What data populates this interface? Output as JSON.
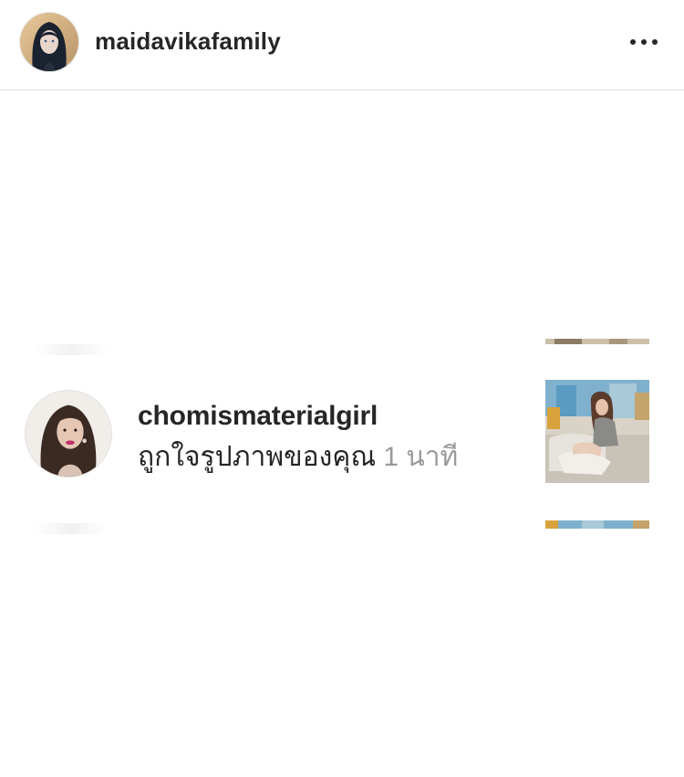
{
  "header": {
    "username": "maidavikafamily",
    "avatar_icon": "profile-photo",
    "more_icon": "more-horizontal-icon"
  },
  "notification": {
    "username": "chomismaterialgirl",
    "action_text": "ถูกใจรูปภาพของคุณ",
    "time_text": "1 นาที",
    "avatar_icon": "profile-photo",
    "post_thumbnail": "liked-post-thumbnail"
  },
  "colors": {
    "text": "#262626",
    "secondary_text": "#9a9a9a",
    "divider": "#dcdcdc",
    "background": "#ffffff"
  }
}
